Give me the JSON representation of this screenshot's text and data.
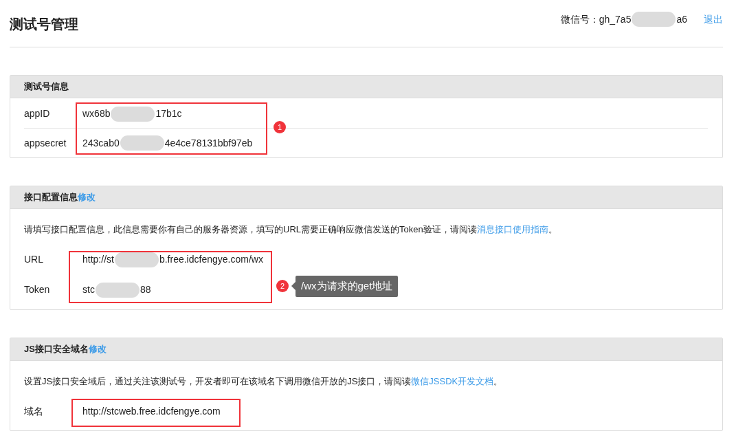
{
  "header": {
    "title": "测试号管理",
    "account_label": "微信号：",
    "account_parts": [
      "gh_7a5",
      "a6"
    ],
    "logout": "退出"
  },
  "sections": [
    {
      "title": "测试号信息",
      "rows": [
        {
          "label": "appID",
          "parts": [
            "wx68b",
            "17b1c"
          ]
        },
        {
          "label": "appsecret",
          "parts": [
            "243cab0",
            "4e4ce78131bbf97eb"
          ]
        }
      ],
      "annotation": {
        "number": "1"
      }
    },
    {
      "title": "接口配置信息",
      "edit": "修改",
      "description": "请填写接口配置信息，此信息需要你有自己的服务器资源，填写的URL需要正确响应微信发送的Token验证，请阅读",
      "link": "消息接口使用指南",
      "tail": "。",
      "rows": [
        {
          "label": "URL",
          "parts": [
            "http://st",
            "b.free.idcfengye.com/wx"
          ]
        },
        {
          "label": "Token",
          "parts": [
            "stc",
            "88"
          ]
        }
      ],
      "annotation": {
        "number": "2",
        "note": "/wx为请求的get地址"
      }
    },
    {
      "title": "JS接口安全域名",
      "edit": "修改",
      "description": "设置JS接口安全域后，通过关注该测试号，开发者即可在该域名下调用微信开放的JS接口，请阅读",
      "link": "微信JSSDK开发文档",
      "tail": "。",
      "rows": [
        {
          "label": "域名",
          "parts": [
            "http://stcweb.free.idcfengye.com"
          ]
        }
      ]
    }
  ]
}
